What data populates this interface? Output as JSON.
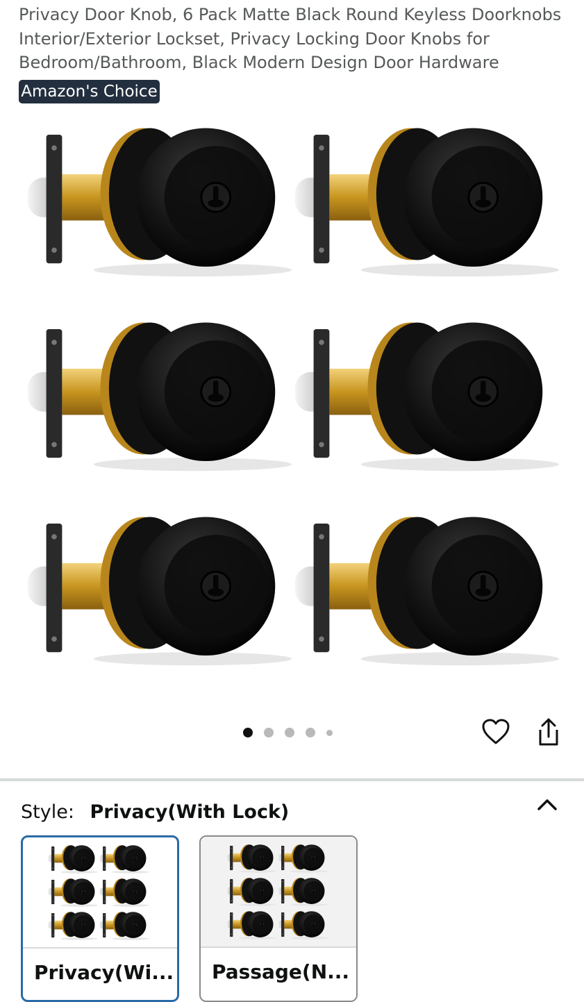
{
  "product": {
    "title_lines": [
      "Privacy Door Knob, 6 Pack Matte Black Round Keyless Doorknobs",
      "Interior/Exterior Lockset, Privacy Locking Door Knobs for",
      "Bedroom/Bathroom, Black Modern Design Door Hardware"
    ],
    "badge": "Amazon's Choice"
  },
  "gallery": {
    "image_count": 5,
    "active_index": 0
  },
  "actions": {
    "favorite_icon": "heart-icon",
    "share_icon": "share-icon"
  },
  "style": {
    "label": "Style:",
    "value": "Privacy(With Lock)",
    "options": [
      {
        "label": "Privacy(Wi...",
        "selected": true
      },
      {
        "label": "Passage(N...",
        "selected": false
      }
    ]
  },
  "colors": {
    "badge_bg": "#232f3e",
    "selected_border": "#2a6aa6",
    "knob_black": "#111111",
    "latch_brass": "#d4a017"
  }
}
